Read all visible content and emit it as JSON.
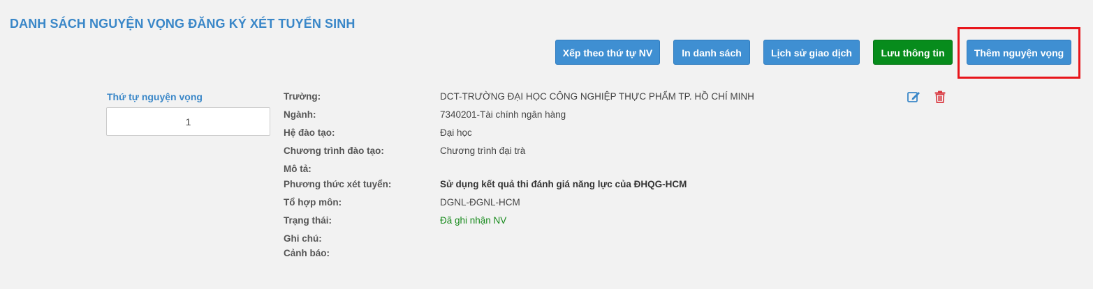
{
  "page": {
    "title": "DANH SÁCH NGUYỆN VỌNG ĐĂNG KÝ XÉT TUYỂN SINH"
  },
  "toolbar": {
    "sort_label": "Xếp theo thứ tự NV",
    "print_label": "In danh sách",
    "history_label": "Lịch sử giao dịch",
    "save_label": "Lưu thông tin",
    "add_label": "Thêm nguyện vọng"
  },
  "wish": {
    "order_label": "Thứ tự nguyện vọng",
    "order_value": "1",
    "fields": [
      {
        "label": "Trường:",
        "value": "DCT-TRƯỜNG ĐẠI HỌC CÔNG NGHIỆP THỰC PHẨM TP. HỒ CHÍ MINH"
      },
      {
        "label": "Ngành:",
        "value": "7340201-Tài chính ngân hàng"
      },
      {
        "label": "Hệ đào tạo:",
        "value": "Đại học"
      },
      {
        "label": "Chương trình đào tạo:",
        "value": "Chương trình đại trà"
      },
      {
        "label": "Mô tả:",
        "value": ""
      },
      {
        "label": "Phương thức xét tuyển:",
        "value": "Sử dụng kết quả thi đánh giá năng lực của ĐHQG-HCM"
      },
      {
        "label": "Tổ hợp môn:",
        "value": "DGNL-ĐGNL-HCM"
      },
      {
        "label": "Trạng thái:",
        "value": "Đã ghi nhận NV"
      },
      {
        "label": "Ghi chú:",
        "value": ""
      },
      {
        "label": "Cảnh báo:",
        "value": ""
      }
    ],
    "actions": {
      "edit_icon": "edit-icon",
      "delete_icon": "trash-icon"
    }
  },
  "colors": {
    "title": "#3a87c8",
    "button_blue": "#3f8fd2",
    "button_green": "#078c1c",
    "highlight": "#e8151b",
    "status_text": "#168a1b",
    "edit_icon": "#3a87c8",
    "delete_icon": "#d9363e"
  }
}
